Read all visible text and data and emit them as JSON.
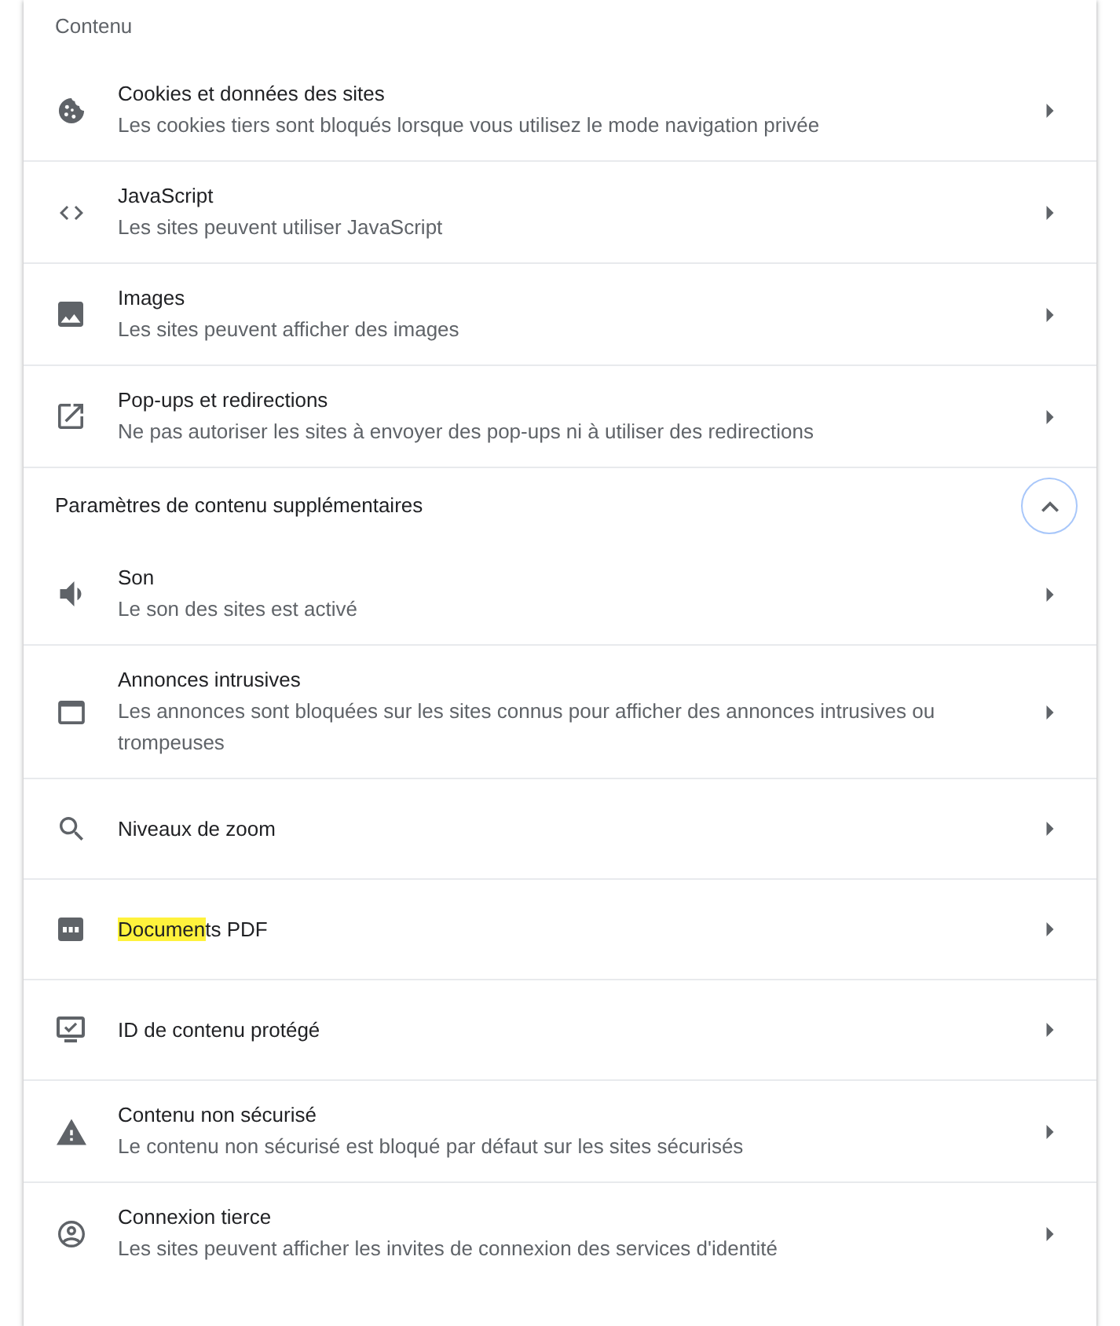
{
  "content": {
    "title": "Contenu",
    "items": [
      {
        "title": "Cookies et données des sites",
        "description": "Les cookies tiers sont bloqués lorsque vous utilisez le mode navigation privée"
      },
      {
        "title": "JavaScript",
        "description": "Les sites peuvent utiliser JavaScript"
      },
      {
        "title": "Images",
        "description": "Les sites peuvent afficher des images"
      },
      {
        "title": "Pop-ups et redirections",
        "description": "Ne pas autoriser les sites à envoyer des pop-ups ni à utiliser des redirections"
      }
    ]
  },
  "additional": {
    "title": "Paramètres de contenu supplémentaires",
    "expanded": true,
    "items": [
      {
        "title": "Son",
        "description": "Le son des sites est activé"
      },
      {
        "title": "Annonces intrusives",
        "description": "Les annonces sont bloquées sur les sites connus pour afficher des annonces intrusives ou trompeuses"
      },
      {
        "title": "Niveaux de zoom"
      },
      {
        "title_parts": [
          {
            "text": "Documen",
            "highlighted": true
          },
          {
            "text": "ts PDF",
            "highlighted": false
          }
        ]
      },
      {
        "title": "ID de contenu protégé"
      },
      {
        "title": "Contenu non sécurisé",
        "description": "Le contenu non sécurisé est bloqué par défaut sur les sites sécurisés"
      },
      {
        "title": "Connexion tierce",
        "description": "Les sites peuvent afficher les invites de connexion des services d'identité"
      }
    ]
  }
}
